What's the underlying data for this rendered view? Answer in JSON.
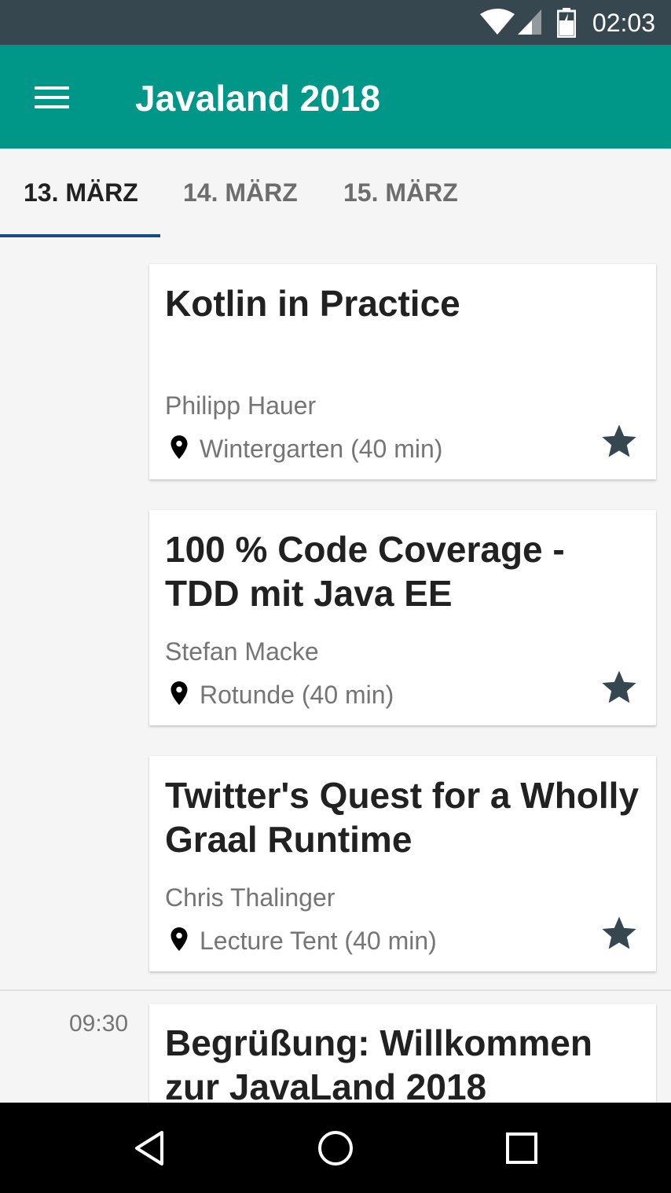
{
  "status_bar": {
    "time": "02:03",
    "icons": [
      "wifi-icon",
      "signal-icon",
      "battery-icon"
    ]
  },
  "app_bar": {
    "title": "Javaland 2018",
    "menu_icon": "hamburger-menu-icon",
    "color": "#009688"
  },
  "tabs": [
    {
      "label": "13. MÄRZ",
      "selected": true
    },
    {
      "label": "14. MÄRZ",
      "selected": false
    },
    {
      "label": "15. MÄRZ",
      "selected": false
    }
  ],
  "sessions": [
    {
      "title": "Kotlin in Practice",
      "speaker": "Philipp Hauer",
      "room": "Wintergarten (40 min)"
    },
    {
      "title": "100 % Code Coverage - TDD mit Java EE",
      "speaker": "Stefan Macke",
      "room": "Rotunde (40 min)"
    },
    {
      "title": "Twitter's Quest for a Wholly Graal Runtime",
      "speaker": "Chris Thalinger",
      "room": "Lecture Tent (40 min)"
    }
  ],
  "next_slot": {
    "time": "09:30",
    "title": "Begrüßung: Willkommen zur JavaLand 2018"
  },
  "nav_bar": {
    "icons": [
      "back-icon",
      "home-icon",
      "recents-icon"
    ]
  }
}
